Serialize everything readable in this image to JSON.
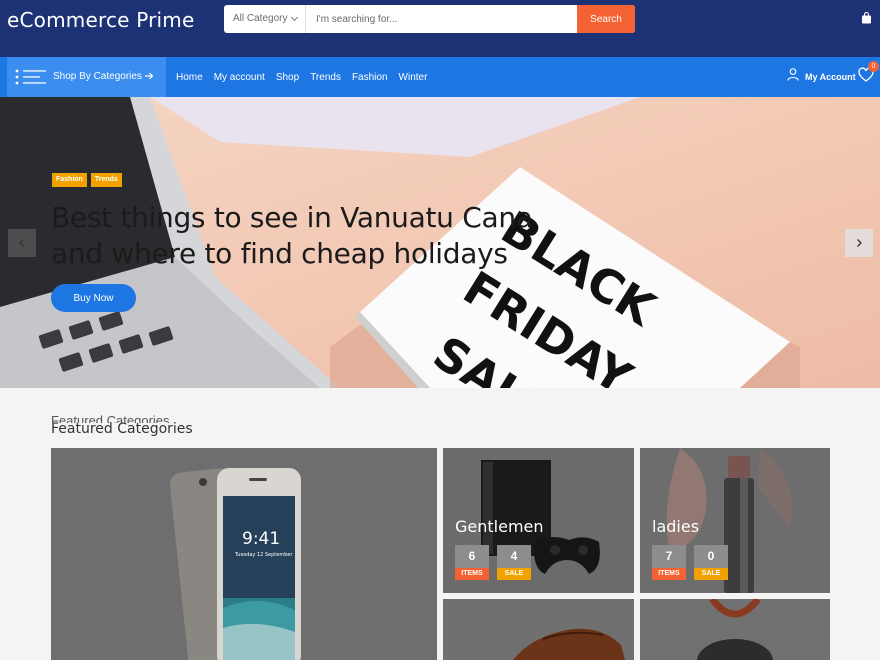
{
  "header": {
    "logo": "eCommerce Prime",
    "search": {
      "category": "All Category",
      "placeholder": "I'm searching for...",
      "button": "Search"
    }
  },
  "nav": {
    "categories_label": "Shop By Categories",
    "links": [
      "Home",
      "My account",
      "Shop",
      "Trends",
      "Fashion",
      "Winter"
    ],
    "account_label": "My Account",
    "wishlist_count": "0"
  },
  "hero": {
    "tags": [
      "Fashion",
      "Trends"
    ],
    "title": "Best things to see in Vanuatu Cana and where to find cheap holidays",
    "button": "Buy Now",
    "sign_text": [
      "BLACK",
      "FRIDAY",
      "SALE"
    ]
  },
  "featured": {
    "ghost_title": "Featured Categories",
    "title": "Featured Categories",
    "tiles": [
      {
        "name": "Gentlemen",
        "items": "6",
        "items_label": "ITEMS",
        "sale": "4",
        "sale_label": "SALE"
      },
      {
        "name": "ladies",
        "items": "7",
        "items_label": "ITEMS",
        "sale": "0",
        "sale_label": "SALE"
      }
    ],
    "phone_time": "9:41",
    "phone_date": "Tuesday 12 September"
  },
  "colors": {
    "header_bg": "#1c3275",
    "nav_bg": "#1e76e3",
    "accent_orange": "#f46234",
    "accent_yellow": "#f2a200"
  }
}
